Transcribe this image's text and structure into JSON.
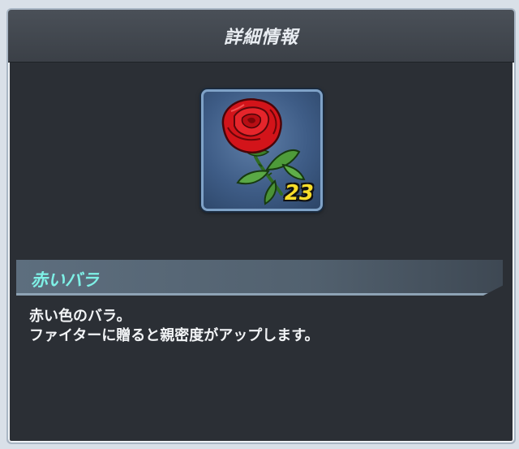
{
  "header": {
    "title": "詳細情報"
  },
  "item": {
    "icon": "red-rose-icon",
    "count": "23",
    "name": "赤いバラ",
    "description": [
      "赤い色のバラ。",
      "ファイターに贈ると親密度がアップします。"
    ]
  },
  "colors": {
    "panel": "#2b2f35",
    "header": "#424850",
    "name_text": "#7ef0e6",
    "count_text": "#f7dd2a"
  }
}
